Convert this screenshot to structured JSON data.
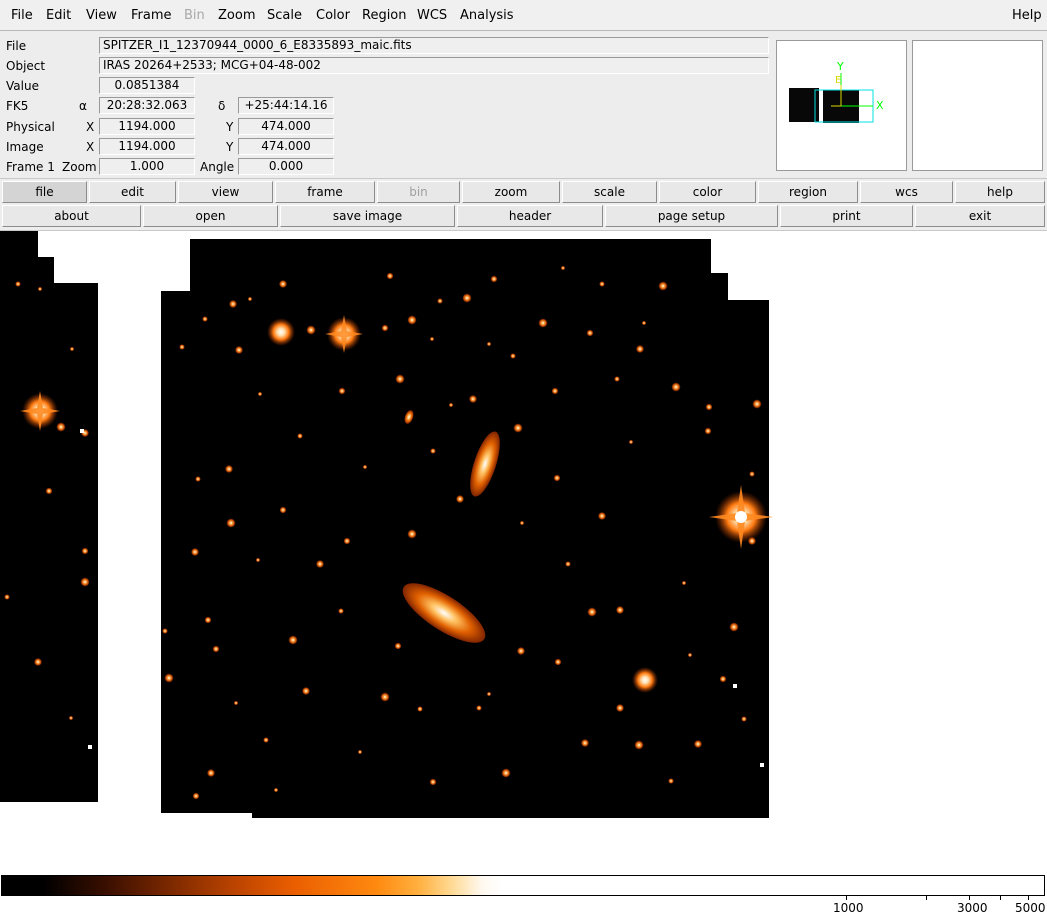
{
  "menu": {
    "file": "File",
    "edit": "Edit",
    "view": "View",
    "frame": "Frame",
    "bin": "Bin",
    "zoom": "Zoom",
    "scale": "Scale",
    "color": "Color",
    "region": "Region",
    "wcs": "WCS",
    "analysis": "Analysis",
    "help": "Help"
  },
  "info": {
    "file_label": "File",
    "file_value": "SPITZER_I1_12370944_0000_6_E8335893_maic.fits",
    "object_label": "Object",
    "object_value": "IRAS 20264+2533; MCG+04-48-002",
    "value_label": "Value",
    "value_value": "0.0851384",
    "fk5_label": "FK5",
    "alpha_symbol": "α",
    "alpha_value": "20:28:32.063",
    "delta_symbol": "δ",
    "delta_value": "+25:44:14.16",
    "physical_label": "Physical",
    "physical_x_label": "X",
    "physical_x": "1194.000",
    "physical_y_label": "Y",
    "physical_y": "474.000",
    "image_label": "Image",
    "image_x_label": "X",
    "image_x": "1194.000",
    "image_y_label": "Y",
    "image_y": "474.000",
    "frame_label": "Frame 1",
    "zoom_label": "Zoom",
    "zoom_value": "1.000",
    "angle_label": "Angle",
    "angle_value": "0.000"
  },
  "panner": {
    "y_label": "Y",
    "x_label": "X",
    "e_label": "E",
    "compass_color": "#00ff00",
    "box_color": "#00e0e0"
  },
  "buttons_row1": {
    "file": "file",
    "edit": "edit",
    "view": "view",
    "frame": "frame",
    "bin": "bin",
    "zoom": "zoom",
    "scale": "scale",
    "color": "color",
    "region": "region",
    "wcs": "wcs",
    "help": "help",
    "active": "file"
  },
  "buttons_row2": {
    "about": "about",
    "open": "open",
    "save_image": "save image",
    "header": "header",
    "page_setup": "page setup",
    "print": "print",
    "exit": "exit"
  },
  "colorbar": {
    "colormap_colors": [
      "#000000",
      "#7a2800",
      "#ea5e00",
      "#ffb040",
      "#ffffff"
    ],
    "tick_labels": [
      "1000",
      "3000",
      "5000"
    ]
  },
  "image": {
    "background_color": "#000000",
    "star_color": "#ff8c20",
    "core_color": "#ffffff"
  }
}
